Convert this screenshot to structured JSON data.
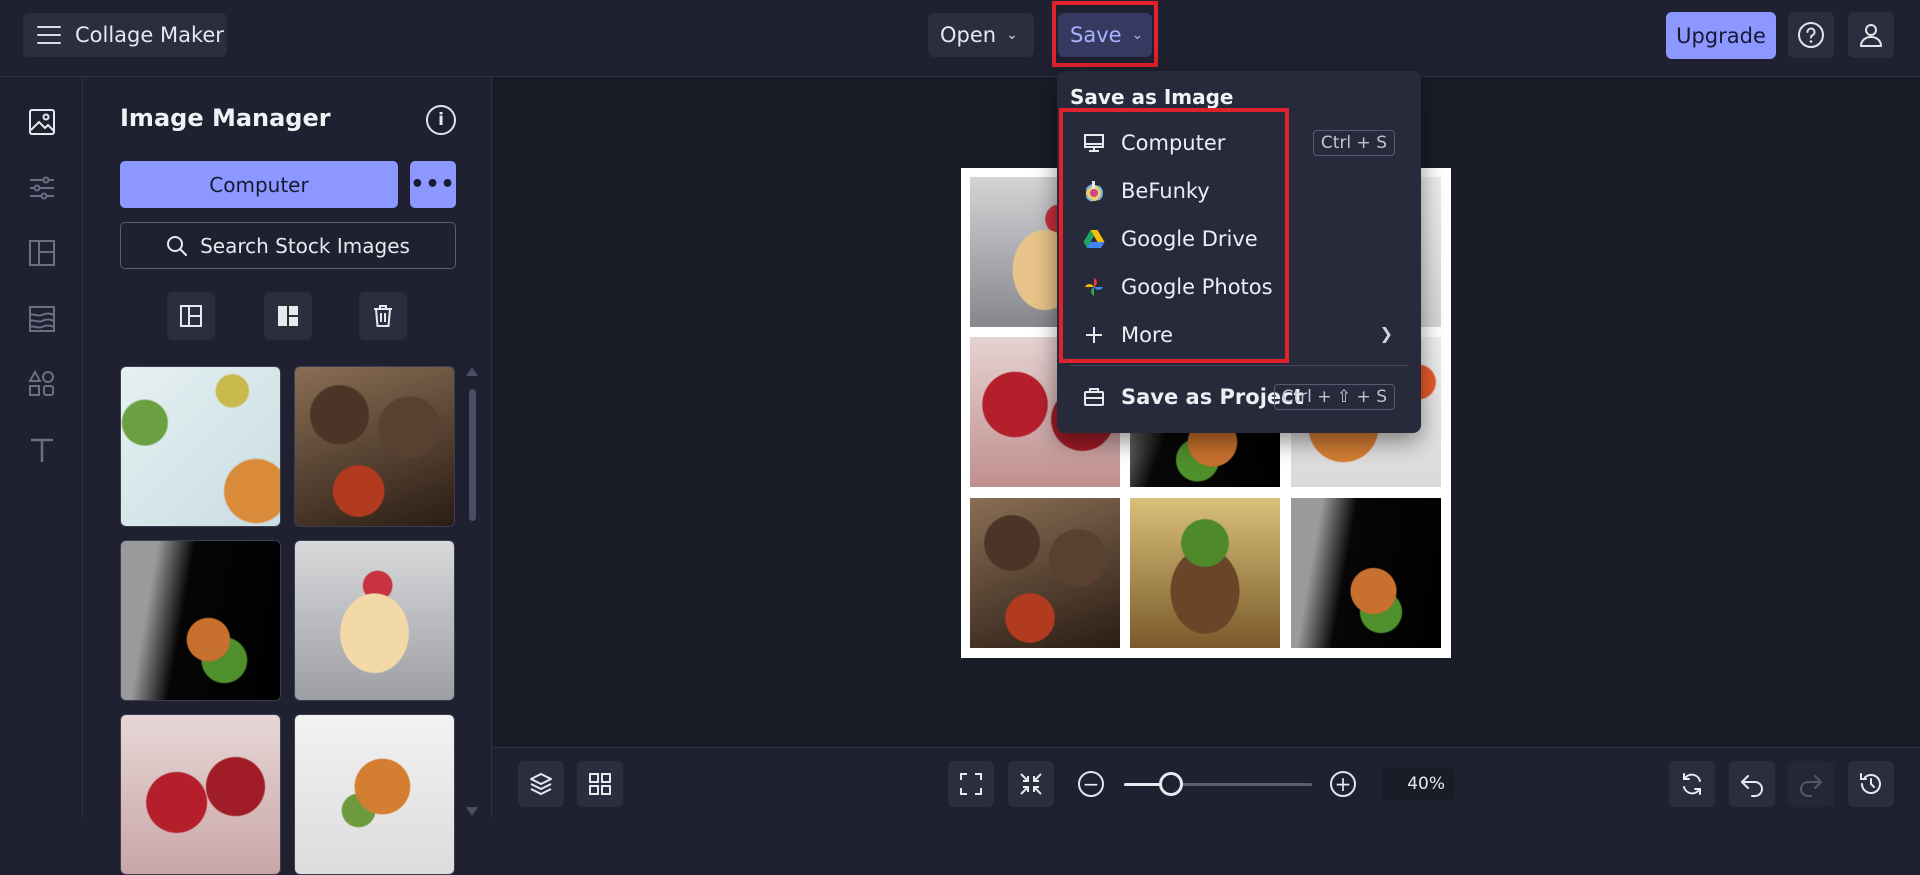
{
  "app": {
    "title": "Collage Maker"
  },
  "topbar": {
    "open_label": "Open",
    "save_label": "Save",
    "upgrade_label": "Upgrade"
  },
  "panel": {
    "title": "Image Manager",
    "computer_label": "Computer",
    "more_label": "•••",
    "stock_label": "Search Stock Images"
  },
  "save_menu": {
    "header": "Save as Image",
    "items": [
      {
        "label": "Computer",
        "shortcut": "Ctrl + S",
        "icon": "monitor-icon"
      },
      {
        "label": "BeFunky",
        "icon": "befunky-icon"
      },
      {
        "label": "Google Drive",
        "icon": "google-drive-icon"
      },
      {
        "label": "Google Photos",
        "icon": "google-photos-icon"
      },
      {
        "label": "More",
        "icon": "plus-icon"
      }
    ],
    "project_label": "Save as Project",
    "project_shortcut": "Ctrl + ⇧ + S"
  },
  "bottombar": {
    "zoom": "40%",
    "zoom_level": 0.25
  },
  "colors": {
    "accent": "#8c98ff",
    "highlight": "#e0222c",
    "background": "#1f2130"
  }
}
